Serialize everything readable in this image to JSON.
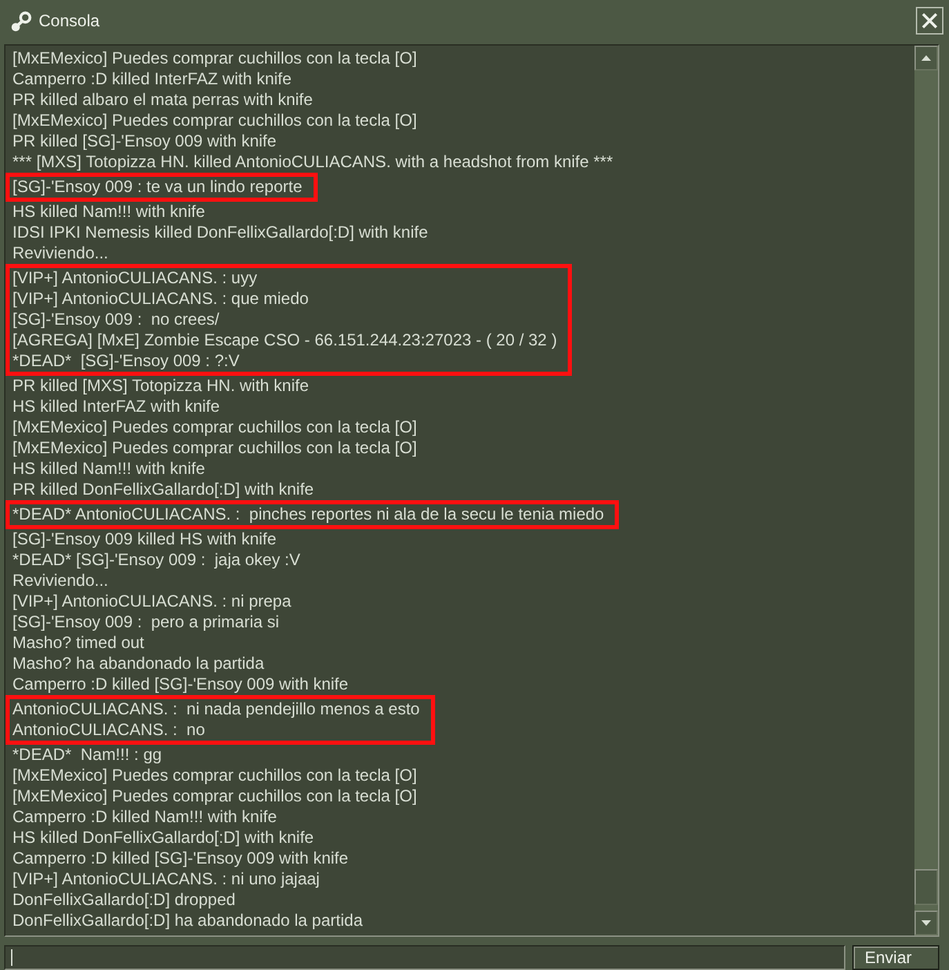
{
  "window": {
    "title": "Consola"
  },
  "console": {
    "lines": [
      {
        "text": "[MxEMexico] Puedes comprar cuchillos con la tecla [O]",
        "highlighted": false
      },
      {
        "text": "Camperro :D killed InterFAZ with knife",
        "highlighted": false
      },
      {
        "text": "PR killed albaro el mata perras with knife",
        "highlighted": false
      },
      {
        "text": "[MxEMexico] Puedes comprar cuchillos con la tecla [O]",
        "highlighted": false
      },
      {
        "text": "PR killed [SG]-'Ensoy 009 with knife",
        "highlighted": false
      },
      {
        "text": "*** [MXS] Totopizza HN. killed AntonioCULIACANS. with a headshot from knife ***",
        "highlighted": false
      },
      {
        "text": "[SG]-'Ensoy 009 : te va un lindo reporte",
        "highlighted": true
      },
      {
        "text": "HS killed Nam!!! with knife",
        "highlighted": false
      },
      {
        "text": "IDSI IPKI Nemesis killed DonFellixGallardo[:D] with knife",
        "highlighted": false
      },
      {
        "text": "Reviviendo...",
        "highlighted": false
      },
      {
        "text": "[VIP+] AntonioCULIACANS. : uyy",
        "highlighted": true
      },
      {
        "text": "[VIP+] AntonioCULIACANS. : que miedo",
        "highlighted": true
      },
      {
        "text": "[SG]-'Ensoy 009 :  no crees/",
        "highlighted": true
      },
      {
        "text": "[AGREGA] [MxE] Zombie Escape CSO - 66.151.244.23:27023 - ( 20 / 32 )",
        "highlighted": true
      },
      {
        "text": "*DEAD*  [SG]-'Ensoy 009 : ?:V",
        "highlighted": true
      },
      {
        "text": "PR killed [MXS] Totopizza HN. with knife",
        "highlighted": false
      },
      {
        "text": "HS killed InterFAZ with knife",
        "highlighted": false
      },
      {
        "text": "[MxEMexico] Puedes comprar cuchillos con la tecla [O]",
        "highlighted": false
      },
      {
        "text": "[MxEMexico] Puedes comprar cuchillos con la tecla [O]",
        "highlighted": false
      },
      {
        "text": "HS killed Nam!!! with knife",
        "highlighted": false
      },
      {
        "text": "PR killed DonFellixGallardo[:D] with knife",
        "highlighted": false
      },
      {
        "text": "*DEAD* AntonioCULIACANS. :  pinches reportes ni ala de la secu le tenia miedo",
        "highlighted": true
      },
      {
        "text": "[SG]-'Ensoy 009 killed HS with knife",
        "highlighted": false
      },
      {
        "text": "*DEAD* [SG]-'Ensoy 009 :  jaja okey :V",
        "highlighted": false
      },
      {
        "text": "Reviviendo...",
        "highlighted": false
      },
      {
        "text": "[VIP+] AntonioCULIACANS. : ni prepa",
        "highlighted": false
      },
      {
        "text": "[SG]-'Ensoy 009 :  pero a primaria si",
        "highlighted": false
      },
      {
        "text": "Masho? timed out",
        "highlighted": false
      },
      {
        "text": "Masho? ha abandonado la partida",
        "highlighted": false
      },
      {
        "text": "Camperro :D killed [SG]-'Ensoy 009 with knife",
        "highlighted": false
      },
      {
        "text": "AntonioCULIACANS. :  ni nada pendejillo menos a esto",
        "highlighted": true
      },
      {
        "text": "AntonioCULIACANS. :  no",
        "highlighted": true
      },
      {
        "text": "*DEAD*  Nam!!! : gg",
        "highlighted": false
      },
      {
        "text": "[MxEMexico] Puedes comprar cuchillos con la tecla [O]",
        "highlighted": false
      },
      {
        "text": "[MxEMexico] Puedes comprar cuchillos con la tecla [O]",
        "highlighted": false
      },
      {
        "text": "Camperro :D killed Nam!!! with knife",
        "highlighted": false
      },
      {
        "text": "HS killed DonFellixGallardo[:D] with knife",
        "highlighted": false
      },
      {
        "text": "Camperro :D killed [SG]-'Ensoy 009 with knife",
        "highlighted": false
      },
      {
        "text": "[VIP+] AntonioCULIACANS. : ni uno jajaaj",
        "highlighted": false
      },
      {
        "text": "DonFellixGallardo[:D] dropped",
        "highlighted": false
      },
      {
        "text": "DonFellixGallardo[:D] ha abandonado la partida",
        "highlighted": false
      }
    ]
  },
  "message_field": {
    "focused": true
  },
  "send_button": {
    "label": "Enviar"
  }
}
